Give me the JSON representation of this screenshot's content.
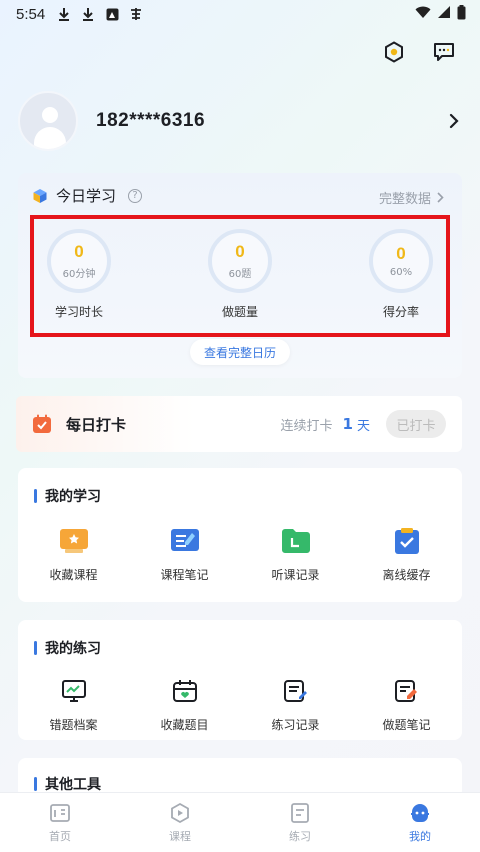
{
  "status_bar": {
    "time": "5:54",
    "icons": [
      "download-icon",
      "download-icon",
      "photo-icon",
      "keyboard-icon"
    ],
    "right_icons": [
      "wifi-icon",
      "signal-icon",
      "battery-icon"
    ]
  },
  "top_actions": [
    "settings-hex-icon",
    "message-icon"
  ],
  "profile": {
    "phone": "182****6316"
  },
  "today": {
    "title": "今日学习",
    "full_data_label": "完整数据",
    "stats": [
      {
        "value": "0",
        "target": "60分钟",
        "label": "学习时长"
      },
      {
        "value": "0",
        "target": "60题",
        "label": "做题量"
      },
      {
        "value": "0",
        "target": "60%",
        "label": "得分率"
      }
    ],
    "calendar_button": "查看完整日历"
  },
  "checkin": {
    "title": "每日打卡",
    "streak_label": "连续打卡",
    "streak_days": "1",
    "streak_unit": "天",
    "button": "已打卡"
  },
  "my_study": {
    "title": "我的学习",
    "items": [
      {
        "label": "收藏课程",
        "icon": "favorite-course-icon"
      },
      {
        "label": "课程笔记",
        "icon": "course-notes-icon"
      },
      {
        "label": "听课记录",
        "icon": "listen-record-icon"
      },
      {
        "label": "离线缓存",
        "icon": "offline-cache-icon"
      }
    ]
  },
  "my_practice": {
    "title": "我的练习",
    "items": [
      {
        "label": "错题档案",
        "icon": "wrong-questions-icon"
      },
      {
        "label": "收藏题目",
        "icon": "favorite-questions-icon"
      },
      {
        "label": "练习记录",
        "icon": "practice-record-icon"
      },
      {
        "label": "做题笔记",
        "icon": "question-notes-icon"
      }
    ]
  },
  "other_tools": {
    "title": "其他工具"
  },
  "tabs": [
    {
      "label": "首页",
      "icon": "home-icon",
      "active": false
    },
    {
      "label": "课程",
      "icon": "course-icon",
      "active": false
    },
    {
      "label": "练习",
      "icon": "practice-icon",
      "active": false
    },
    {
      "label": "我的",
      "icon": "mine-icon",
      "active": true
    }
  ],
  "colors": {
    "accent": "#3a78e0",
    "stat_value": "#f0b818",
    "highlight_border": "#e5151b"
  }
}
